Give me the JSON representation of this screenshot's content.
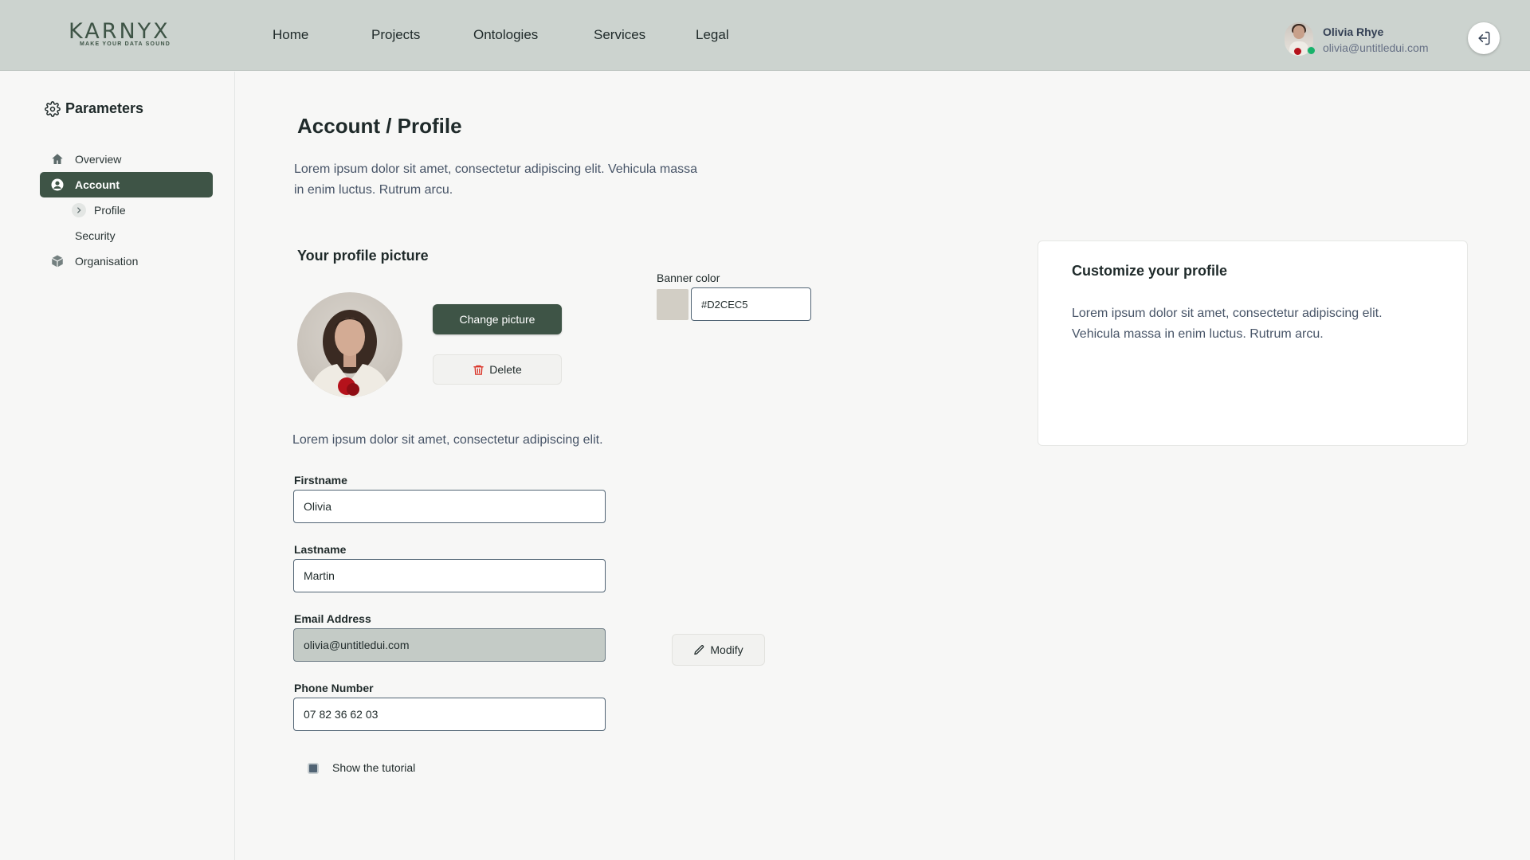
{
  "brand": {
    "name": "KARNYX",
    "tagline": "MAKE YOUR DATA SOUND"
  },
  "nav": [
    {
      "label": "Home"
    },
    {
      "label": "Projects"
    },
    {
      "label": "Ontologies"
    },
    {
      "label": "Services"
    },
    {
      "label": "Legal"
    }
  ],
  "user": {
    "name": "Olivia Rhye",
    "email": "olivia@untitledui.com",
    "status": "online"
  },
  "sidebar": {
    "title": "Parameters",
    "items": [
      {
        "label": "Overview",
        "icon": "home-icon",
        "active": false
      },
      {
        "label": "Account",
        "icon": "user-circle-icon",
        "active": true
      },
      {
        "label": "Profile",
        "icon": "chevron-right-icon",
        "active": false
      },
      {
        "label": "Security",
        "active": false
      },
      {
        "label": "Organisation",
        "icon": "cube-icon",
        "active": false
      }
    ]
  },
  "page": {
    "title": "Account / Profile",
    "description": "Lorem ipsum dolor sit amet, consectetur adipiscing elit. Vehicula massa in enim luctus. Rutrum arcu."
  },
  "profile_picture": {
    "title": "Your profile picture",
    "change_label": "Change picture",
    "delete_label": "Delete"
  },
  "banner": {
    "label": "Banner color",
    "value": "#D2CEC5"
  },
  "customize": {
    "title": "Customize your profile",
    "description": "Lorem ipsum dolor sit amet, consectetur adipiscing elit. Vehicula massa in enim luctus. Rutrum arcu."
  },
  "form": {
    "description": "Lorem ipsum dolor sit amet, consectetur adipiscing elit.",
    "firstname": {
      "label": "Firstname",
      "value": "Olivia"
    },
    "lastname": {
      "label": "Lastname",
      "value": "Martin"
    },
    "email": {
      "label": "Email Address",
      "value": "olivia@untitledui.com"
    },
    "phone": {
      "label": "Phone Number",
      "value": "07 82 36 62 03"
    },
    "modify_label": "Modify",
    "tutorial": {
      "label": "Show the tutorial",
      "checked": true
    }
  },
  "colors": {
    "accent": "#3E5446",
    "topbar": "#CCD3CF",
    "danger": "#D92D20",
    "online": "#17B26A"
  }
}
